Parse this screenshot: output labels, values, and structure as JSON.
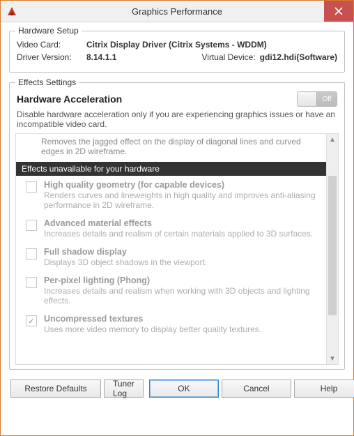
{
  "window": {
    "title": "Graphics Performance"
  },
  "hardware_setup": {
    "group_title": "Hardware Setup",
    "video_card_label": "Video Card:",
    "video_card_value": "Citrix Display Driver (Citrix Systems - WDDM)",
    "driver_version_label": "Driver Version:",
    "driver_version_value": "8.14.1.1",
    "virtual_device_label": "Virtual Device:",
    "virtual_device_value": "gdi12.hdi(Software)"
  },
  "effects": {
    "group_title": "Effects Settings",
    "hw_accel_title": "Hardware Acceleration",
    "toggle_off_label": "Off",
    "hw_accel_desc": "Disable hardware acceleration only if you are experiencing graphics issues or have an incompatible video card.",
    "prev_item_desc": "Removes the jagged effect on the display of diagonal lines and curved edges in 2D wireframe.",
    "section_header": "Effects unavailable for your hardware",
    "items": [
      {
        "title": "High quality geometry (for capable devices)",
        "desc": "Renders curves and lineweights in high quality and improves anti-aliasing performance in 2D wireframe.",
        "checked": false
      },
      {
        "title": "Advanced material effects",
        "desc": "Increases details and realism of certain materials applied to 3D surfaces.",
        "checked": false
      },
      {
        "title": "Full shadow display",
        "desc": "Displays 3D object shadows in the viewport.",
        "checked": false
      },
      {
        "title": "Per-pixel lighting (Phong)",
        "desc": "Increases details and realism when working with 3D objects and lighting effects.",
        "checked": false
      },
      {
        "title": "Uncompressed textures",
        "desc": "Uses more video memory to display better quality textures.",
        "checked": true
      }
    ]
  },
  "footer": {
    "restore_defaults": "Restore Defaults",
    "tuner_log": "Tuner Log",
    "ok": "OK",
    "cancel": "Cancel",
    "help": "Help"
  }
}
